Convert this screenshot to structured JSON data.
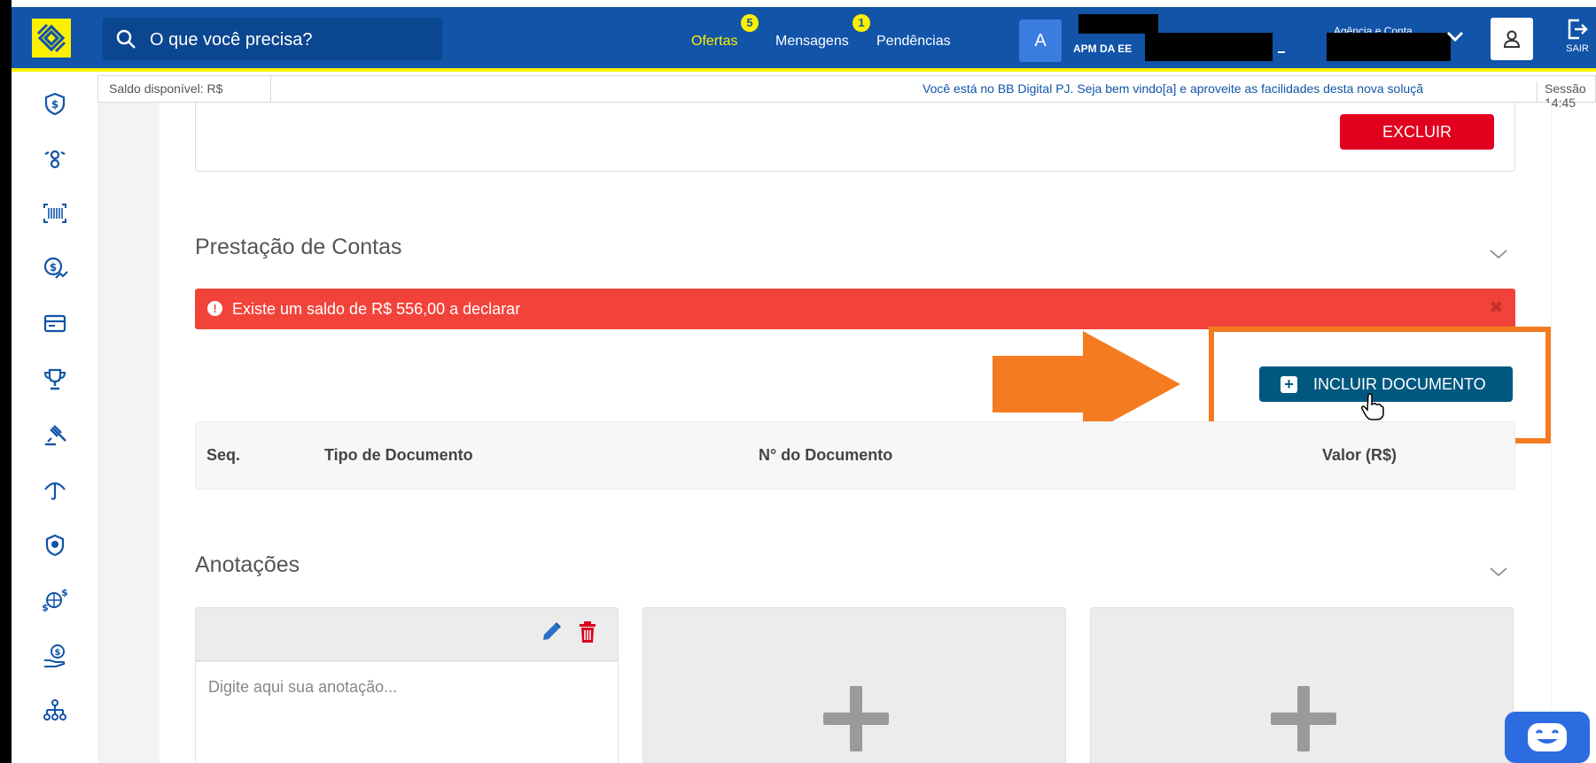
{
  "topbar": {
    "search_placeholder": "O que você precisa?",
    "nav": [
      {
        "label": "Ofertas",
        "badge": "5"
      },
      {
        "label": "Mensagens",
        "badge": "1"
      },
      {
        "label": "Pendências"
      }
    ],
    "avatar_letter": "A",
    "company_name": "APM DA EE",
    "agencia_label": "Agência e Conta",
    "sair_label": "SAIR"
  },
  "infobar": {
    "saldo_label": "Saldo disponível: R$",
    "marquee": "Você está no BB Digital PJ. Seja bem vindo[a] e aproveite as facilidades desta nova soluçã",
    "sessao": "Sessão 14:45"
  },
  "sidebar": {
    "icons": [
      "shield-dollar-icon",
      "transfer-icon",
      "barcode-icon",
      "investment-icon",
      "card-icon",
      "trophy-icon",
      "auction-icon",
      "umbrella-icon",
      "insurance-icon",
      "exchange-icon",
      "loan-icon",
      "organization-icon"
    ]
  },
  "top_card": {
    "excluir_label": "EXCLUIR"
  },
  "prestacao": {
    "title": "Prestação de Contas",
    "alert_text": "Existe um saldo de R$ 556,00 a declarar",
    "incluir_label": "INCLUIR DOCUMENTO",
    "columns": [
      "Seq.",
      "Tipo de Documento",
      "N° do Documento",
      "Valor (R$)"
    ]
  },
  "anotacoes": {
    "title": "Anotações",
    "placeholder": "Digite aqui sua anotação..."
  },
  "colors": {
    "brand_blue": "#1154a8",
    "brand_yellow": "#fcf000",
    "alert_red": "#f2433a",
    "excluir_red": "#e1001d",
    "incluir_blue": "#005880",
    "highlight_orange": "#f47b20"
  }
}
